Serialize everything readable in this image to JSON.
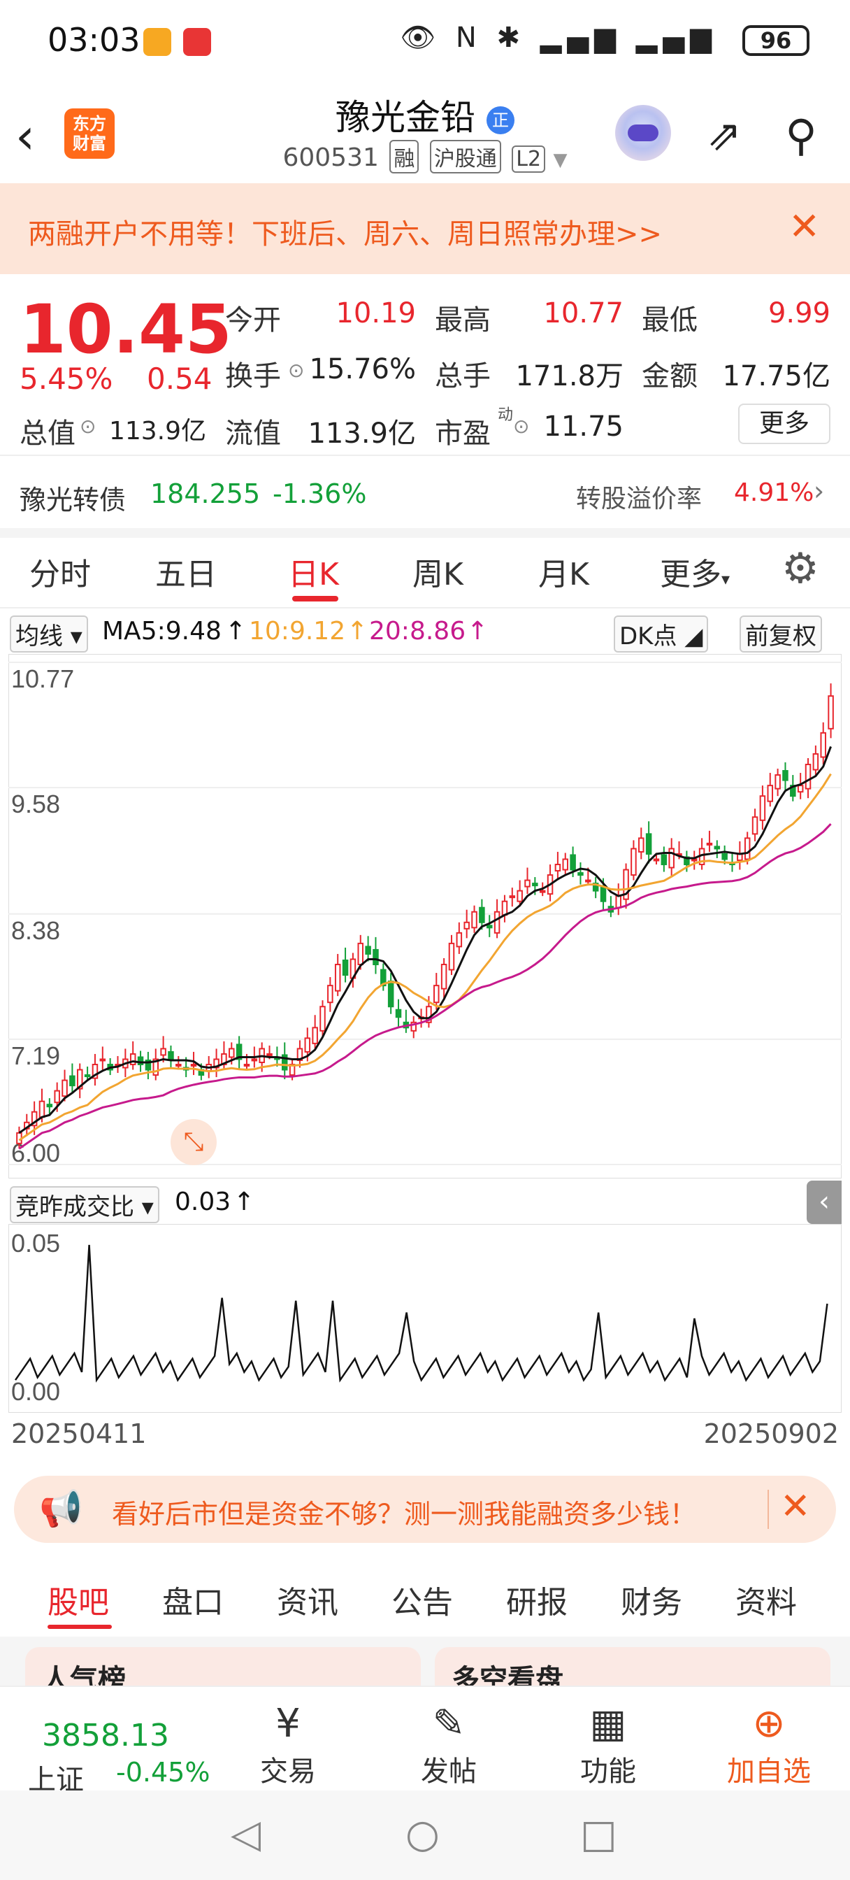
{
  "status_bar": {
    "time": "03:03",
    "battery": "96"
  },
  "header": {
    "logo_line1": "东方",
    "logo_line2": "财富",
    "stock_name": "豫光金铅",
    "stock_badge": "正",
    "stock_code": "600531",
    "tag1": "融",
    "tag2": "沪股通",
    "tag3": "L2"
  },
  "banner": {
    "text": "两融开户不用等！下班后、周六、周日照常办理>>"
  },
  "quote": {
    "price": "10.45",
    "pct": "5.45%",
    "change": "0.54",
    "open_label": "今开",
    "open": "10.19",
    "high_label": "最高",
    "high": "10.77",
    "low_label": "最低",
    "low": "9.99",
    "turnover_label": "换手",
    "turnover": "15.76%",
    "volume_label": "总手",
    "volume": "171.8万",
    "amount_label": "金额",
    "amount": "17.75亿",
    "mktcap_label": "总值",
    "mktcap": "113.9亿",
    "float_label": "流值",
    "float": "113.9亿",
    "pe_label": "市盈",
    "pe_sup": "动",
    "pe": "11.75",
    "more": "更多"
  },
  "bond": {
    "name": "豫光转债",
    "price": "184.255",
    "pct": "-1.36%",
    "premium_label": "转股溢价率",
    "premium": "4.91%"
  },
  "tabs": [
    "分时",
    "五日",
    "日K",
    "周K",
    "月K",
    "更多"
  ],
  "active_tab": "日K",
  "ma": {
    "selector": "均线",
    "ma5": "MA5:9.48",
    "ma10": "10:9.12",
    "ma20": "20:8.86",
    "dk": "DK点",
    "fq": "前复权"
  },
  "colors": {
    "ma5": "#111111",
    "ma10": "#f2a531",
    "ma20": "#c61a8c",
    "up": "#e8262d",
    "down": "#13a039",
    "accent": "#ee5a1e"
  },
  "volume": {
    "selector": "竞昨成交比",
    "value": "0.03"
  },
  "dates": {
    "start": "20250411",
    "end": "20250902"
  },
  "ad": {
    "text": "看好后市但是资金不够？测一测我能融资多少钱！"
  },
  "bottom_tabs": [
    "股吧",
    "盘口",
    "资讯",
    "公告",
    "研报",
    "财务",
    "资料"
  ],
  "cards": {
    "left": "人气榜",
    "right": "多空看盘"
  },
  "navbar": {
    "index_value": "3858.13",
    "index_name": "上证",
    "index_pct": "-0.45%",
    "trade": "交易",
    "post": "发帖",
    "func": "功能",
    "add": "加自选"
  },
  "chart_data": {
    "type": "candlestick",
    "y_ticks": [
      "10.77",
      "9.58",
      "8.38",
      "7.19",
      "6.00"
    ],
    "ylim": [
      6.0,
      10.77
    ],
    "x_start": "20250411",
    "x_end": "20250902",
    "close": [
      6.3,
      6.4,
      6.5,
      6.6,
      6.55,
      6.7,
      6.8,
      6.75,
      6.9,
      6.85,
      6.95,
      7.0,
      6.9,
      6.95,
      7.0,
      7.05,
      6.95,
      6.9,
      7.0,
      7.1,
      7.0,
      6.95,
      6.9,
      6.95,
      6.85,
      6.95,
      7.0,
      7.05,
      7.1,
      7.0,
      6.95,
      7.0,
      7.1,
      7.05,
      7.0,
      6.9,
      6.95,
      7.1,
      7.2,
      7.3,
      7.5,
      7.7,
      7.9,
      7.8,
      7.95,
      8.1,
      8.0,
      7.9,
      7.7,
      7.5,
      7.4,
      7.3,
      7.35,
      7.4,
      7.5,
      7.7,
      7.9,
      8.1,
      8.2,
      8.3,
      8.4,
      8.3,
      8.25,
      8.4,
      8.5,
      8.55,
      8.6,
      8.7,
      8.65,
      8.6,
      8.75,
      8.85,
      8.9,
      8.8,
      8.75,
      8.7,
      8.6,
      8.5,
      8.4,
      8.55,
      8.8,
      9.0,
      9.1,
      8.95,
      8.9,
      8.85,
      9.0,
      8.95,
      8.85,
      8.9,
      9.0,
      9.05,
      9.0,
      8.9,
      8.85,
      8.95,
      9.1,
      9.3,
      9.5,
      9.6,
      9.7,
      9.65,
      9.5,
      9.6,
      9.8,
      9.9,
      10.1,
      10.45
    ],
    "vol_ratio_ylim": [
      0,
      0.05
    ],
    "vol_ratio_ticks": [
      "0.05",
      "0.00"
    ],
    "vol_ratio_last": 0.03
  }
}
